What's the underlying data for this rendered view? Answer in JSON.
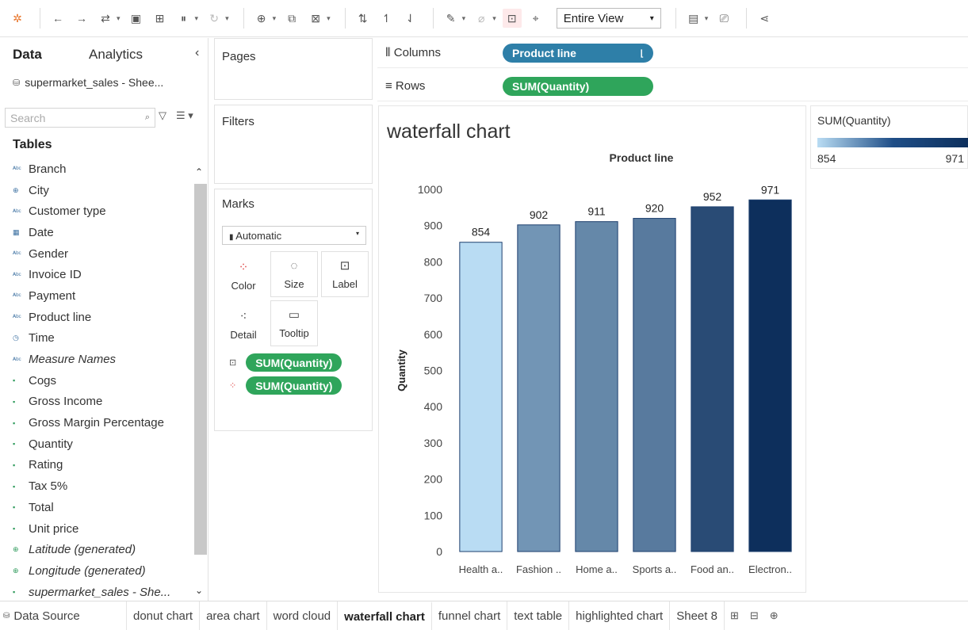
{
  "toolbar": {
    "view_mode": "Entire View",
    "icons": [
      "tableau-logo-icon",
      "undo-icon",
      "redo-icon",
      "swap-data-source-icon",
      "save-icon",
      "new-datasource-icon",
      "pause-icon",
      "refresh-icon",
      "new-worksheet-icon",
      "duplicate-icon",
      "clear-icon",
      "swap-axes-icon",
      "sort-ascending-icon",
      "sort-descending-icon",
      "highlight-icon",
      "group-icon",
      "labels-icon",
      "fix-axes-icon",
      "show-cards-icon",
      "presentation-icon",
      "share-icon"
    ]
  },
  "data_pane": {
    "tab_data": "Data",
    "tab_analytics": "Analytics",
    "collapse": "‹",
    "data_source": "supermarket_sales - Shee...",
    "search_placeholder": "Search",
    "tables_heading": "Tables",
    "fields": [
      {
        "label": "Branch",
        "kind": "dimension"
      },
      {
        "label": "City",
        "kind": "geo"
      },
      {
        "label": "Customer type",
        "kind": "dimension"
      },
      {
        "label": "Date",
        "kind": "date"
      },
      {
        "label": "Gender",
        "kind": "dimension"
      },
      {
        "label": "Invoice ID",
        "kind": "dimension"
      },
      {
        "label": "Payment",
        "kind": "dimension"
      },
      {
        "label": "Product line",
        "kind": "dimension"
      },
      {
        "label": "Time",
        "kind": "time"
      },
      {
        "label": "Measure Names",
        "kind": "dimension",
        "italic": true
      },
      {
        "label": "Cogs",
        "kind": "measure"
      },
      {
        "label": "Gross Income",
        "kind": "measure"
      },
      {
        "label": "Gross Margin Percentage",
        "kind": "measure"
      },
      {
        "label": "Quantity",
        "kind": "measure"
      },
      {
        "label": "Rating",
        "kind": "measure"
      },
      {
        "label": "Tax 5%",
        "kind": "measure"
      },
      {
        "label": "Total",
        "kind": "measure"
      },
      {
        "label": "Unit price",
        "kind": "measure"
      },
      {
        "label": "Latitude (generated)",
        "kind": "geo-measure",
        "italic": true
      },
      {
        "label": "Longitude (generated)",
        "kind": "geo-measure",
        "italic": true
      },
      {
        "label": "supermarket_sales - She...",
        "kind": "measure",
        "italic": true
      }
    ]
  },
  "cards": {
    "pages": "Pages",
    "filters": "Filters",
    "marks": "Marks",
    "mark_type": "Automatic",
    "buttons": {
      "color": "Color",
      "size": "Size",
      "label": "Label",
      "detail": "Detail",
      "tooltip": "Tooltip"
    },
    "mark_pills": [
      "SUM(Quantity)",
      "SUM(Quantity)"
    ]
  },
  "shelves": {
    "columns_label": "Columns",
    "columns_pill": "Product line",
    "rows_label": "Rows",
    "rows_pill": "SUM(Quantity)"
  },
  "view": {
    "title": "waterfall chart"
  },
  "legend": {
    "title": "SUM(Quantity)",
    "min": "854",
    "max": "971",
    "colors": [
      "#b9dcf3",
      "#0d2f5c"
    ]
  },
  "chart_data": {
    "type": "bar",
    "title": "waterfall chart",
    "header": "Product line",
    "ylabel": "Quantity",
    "xlabel": "",
    "categories": [
      "Health a..",
      "Fashion ..",
      "Home a..",
      "Sports a..",
      "Food an..",
      "Electron.."
    ],
    "values": [
      854,
      902,
      911,
      920,
      952,
      971
    ],
    "yticks": [
      0,
      100,
      200,
      300,
      400,
      500,
      600,
      700,
      800,
      900,
      1000
    ],
    "ylim": [
      0,
      1000
    ],
    "grid": false,
    "color_scale": [
      "#b9dcf3",
      "#0d2f5c"
    ]
  },
  "sheet_tabs": {
    "data_source": "Data Source",
    "tabs": [
      "donut chart",
      "area chart",
      "word cloud",
      "waterfall chart",
      "funnel chart",
      "text table",
      "highlighted chart",
      "Sheet 8"
    ],
    "active": 3
  }
}
